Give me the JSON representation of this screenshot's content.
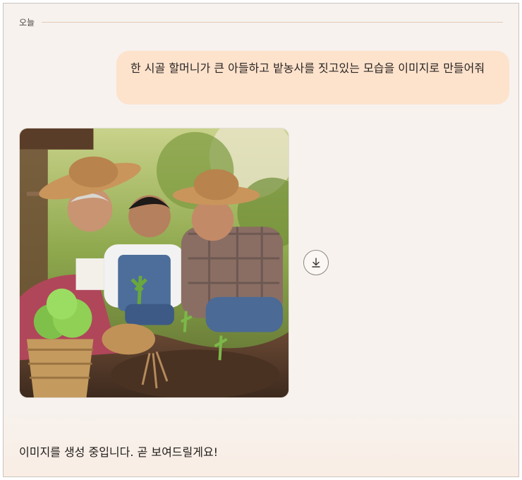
{
  "chat": {
    "date_divider": "오늘",
    "user_message": "한 시골 할머니가 큰 아들하고 밭농사를 짓고있는 모습을 이미지로 만들어줘",
    "image": {
      "alt": "할머니와 아들, 손자가 밭에 모종을 심는 모습"
    },
    "download_icon": "download-icon",
    "assistant_message": "이미지를 생성 중입니다. 곧 보여드릴게요!"
  },
  "colors": {
    "background": "#f7f2ee",
    "user_bubble": "#fde2cc",
    "divider": "#e3c8b6"
  }
}
